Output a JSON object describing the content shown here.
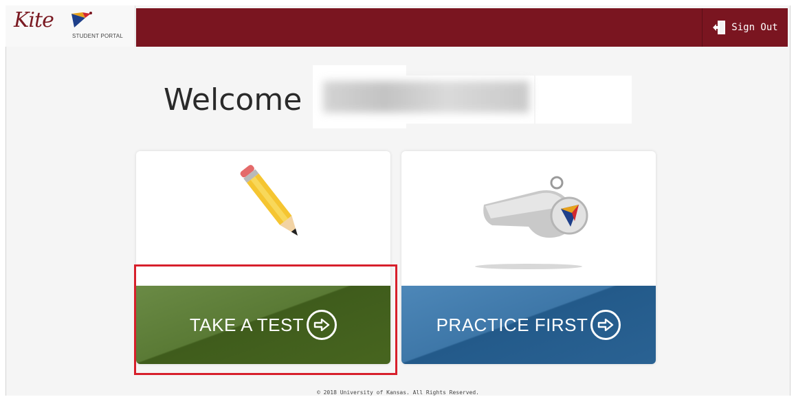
{
  "header": {
    "logo_word": "Kite",
    "logo_sub": "STUDENT PORTAL",
    "signout_label": "Sign Out"
  },
  "welcome": {
    "text": "Welcome"
  },
  "cards": {
    "take_test_label": "TAKE A TEST",
    "practice_label": "PRACTICE FIRST",
    "take_test_icon": "pencil-icon",
    "practice_icon": "whistle-icon"
  },
  "footer": {
    "copyright": "© 2018 University of Kansas. All Rights Reserved."
  },
  "colors": {
    "header_bar": "#7a1520",
    "take_test": "#47651f",
    "practice": "#2a6293",
    "highlight": "#d71f2b"
  }
}
